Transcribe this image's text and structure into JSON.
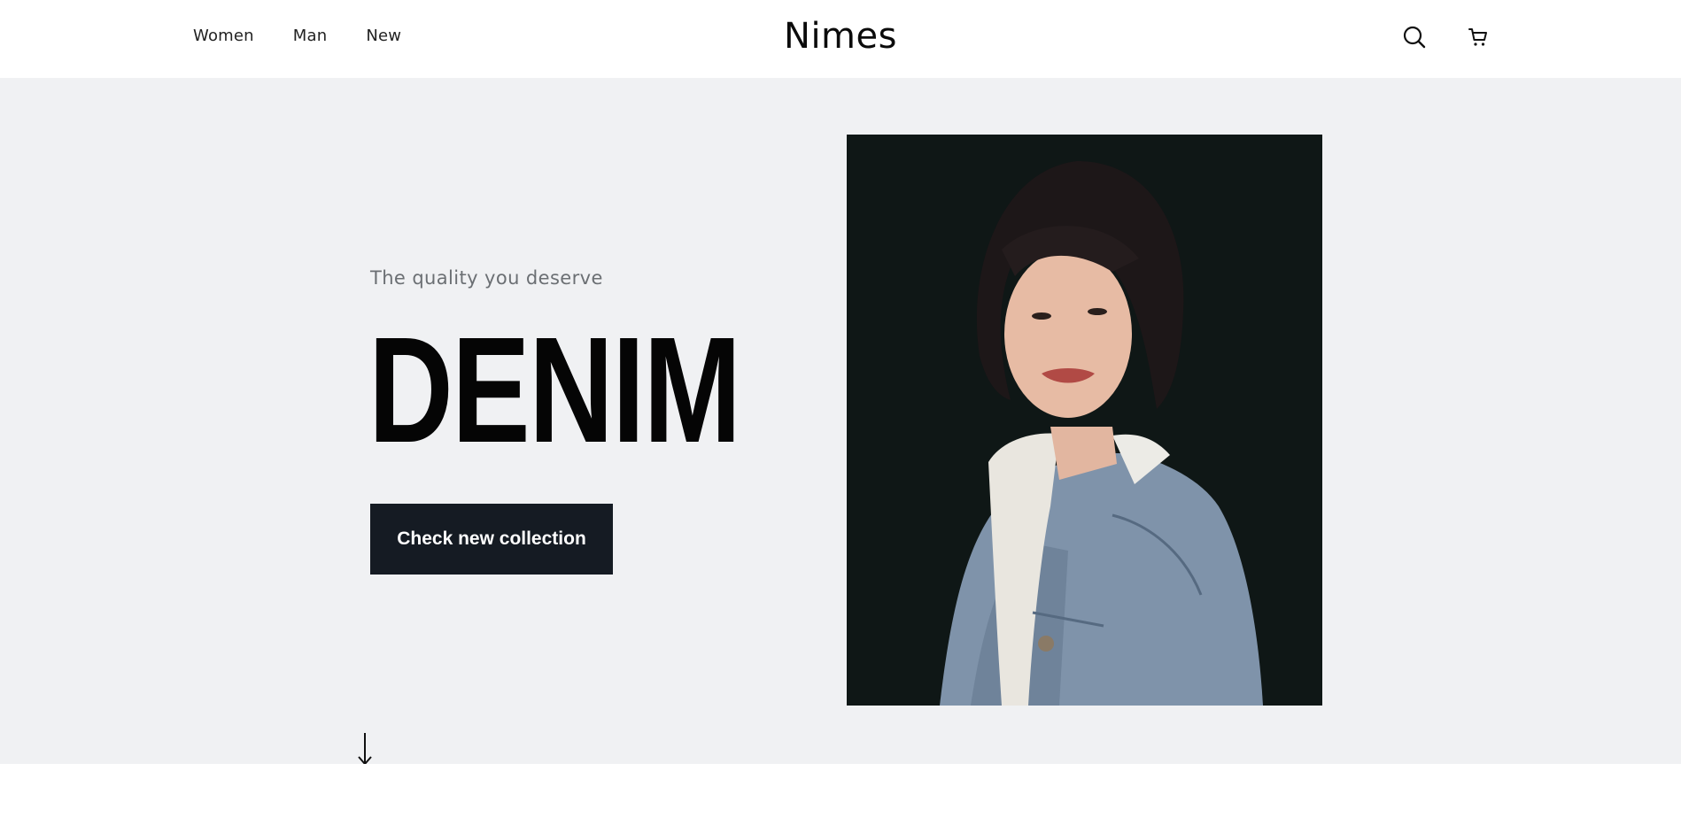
{
  "header": {
    "nav": [
      {
        "label": "Women"
      },
      {
        "label": "Man"
      },
      {
        "label": "New"
      }
    ],
    "brand": "Nimes",
    "icons": {
      "search": "search-icon",
      "cart": "cart-icon"
    }
  },
  "hero": {
    "tagline": "The quality you deserve",
    "headline": "DENIM",
    "cta_label": "Check new collection",
    "scroll_icon": "down-arrow-icon",
    "image": "model-in-denim-jacket"
  },
  "colors": {
    "hero_bg": "#f0f1f3",
    "cta_bg": "#151b23",
    "photo_bg": "#0f1716"
  }
}
